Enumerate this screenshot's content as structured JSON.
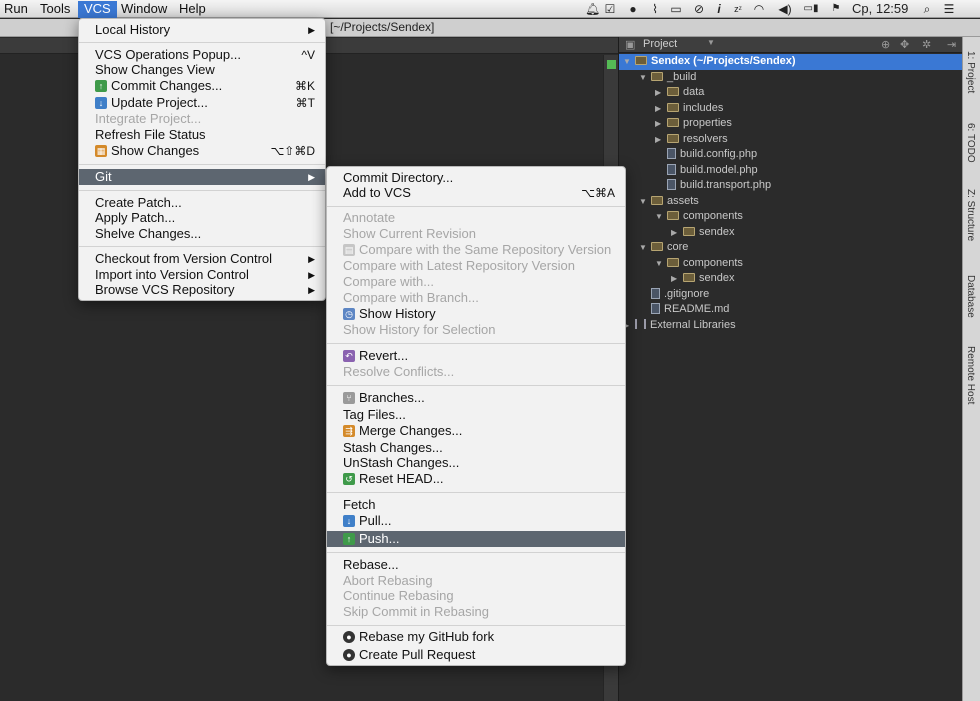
{
  "menubar": {
    "items": [
      "Run",
      "Tools",
      "VCS",
      "Window",
      "Help"
    ],
    "clock": "Ср, 12:59"
  },
  "titlebar": {
    "path": "[~/Projects/Sendex]"
  },
  "vcs_menu": {
    "items": [
      {
        "label": "Local History"
      },
      {
        "label": "VCS Operations Popup...",
        "shortcut": "^V"
      },
      {
        "label": "Show Changes View"
      },
      {
        "label": "Commit Changes...",
        "shortcut": "⌘K"
      },
      {
        "label": "Update Project...",
        "shortcut": "⌘T"
      },
      {
        "label": "Integrate Project..."
      },
      {
        "label": "Refresh File Status"
      },
      {
        "label": "Show Changes",
        "shortcut": "⌥⇧⌘D"
      },
      {
        "label": "Git"
      },
      {
        "label": "Create Patch..."
      },
      {
        "label": "Apply Patch..."
      },
      {
        "label": "Shelve Changes..."
      },
      {
        "label": "Checkout from Version Control"
      },
      {
        "label": "Import into Version Control"
      },
      {
        "label": "Browse VCS Repository"
      }
    ]
  },
  "git_menu": {
    "items": [
      {
        "label": "Commit Directory..."
      },
      {
        "label": "Add to VCS",
        "shortcut": "⌥⌘A"
      },
      {
        "label": "Annotate"
      },
      {
        "label": "Show Current Revision"
      },
      {
        "label": "Compare with the Same Repository Version"
      },
      {
        "label": "Compare with Latest Repository Version"
      },
      {
        "label": "Compare with..."
      },
      {
        "label": "Compare with Branch..."
      },
      {
        "label": "Show History"
      },
      {
        "label": "Show History for Selection"
      },
      {
        "label": "Revert..."
      },
      {
        "label": "Resolve Conflicts..."
      },
      {
        "label": "Branches..."
      },
      {
        "label": "Tag Files..."
      },
      {
        "label": "Merge Changes..."
      },
      {
        "label": "Stash Changes..."
      },
      {
        "label": "UnStash Changes..."
      },
      {
        "label": "Reset HEAD..."
      },
      {
        "label": "Fetch"
      },
      {
        "label": "Pull..."
      },
      {
        "label": "Push..."
      },
      {
        "label": "Rebase..."
      },
      {
        "label": "Abort Rebasing"
      },
      {
        "label": "Continue Rebasing"
      },
      {
        "label": "Skip Commit in Rebasing"
      },
      {
        "label": "Rebase my GitHub fork"
      },
      {
        "label": "Create Pull Request"
      }
    ]
  },
  "project_panel": {
    "title": "Project",
    "tree": [
      {
        "label": "Sendex (~/Projects/Sendex)"
      },
      {
        "label": "_build"
      },
      {
        "label": "data"
      },
      {
        "label": "includes"
      },
      {
        "label": "properties"
      },
      {
        "label": "resolvers"
      },
      {
        "label": "build.config.php"
      },
      {
        "label": "build.model.php"
      },
      {
        "label": "build.transport.php"
      },
      {
        "label": "assets"
      },
      {
        "label": "components"
      },
      {
        "label": "sendex"
      },
      {
        "label": "core"
      },
      {
        "label": "components"
      },
      {
        "label": "sendex"
      },
      {
        "label": ".gitignore"
      },
      {
        "label": "README.md"
      },
      {
        "label": "External Libraries"
      }
    ]
  },
  "tool_windows": [
    "1: Project",
    "6: TODO",
    "Z: Structure",
    "Database",
    "Remote Host"
  ]
}
